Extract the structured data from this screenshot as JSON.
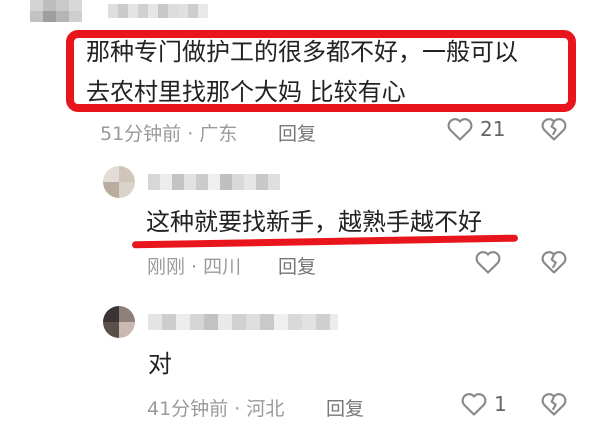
{
  "colors": {
    "highlight": "#e8161c",
    "meta": "#9a9a9a",
    "text": "#222222"
  },
  "comments": [
    {
      "text_line1": "那种专门做护工的很多都不好，一般可以",
      "text_line2": "去农村里找那个大妈   比较有心",
      "time": "51分钟前",
      "location": "广东",
      "reply": "回复",
      "likes": "21"
    },
    {
      "text": "这种就要找新手，越熟手越不好",
      "time": "刚刚",
      "location": "四川",
      "reply": "回复",
      "likes": ""
    },
    {
      "text": "对",
      "time": "41分钟前",
      "location": "河北",
      "reply": "回复",
      "likes": "1"
    }
  ],
  "icons": [
    "heart-icon",
    "broken-heart-icon",
    "avatar-image"
  ]
}
